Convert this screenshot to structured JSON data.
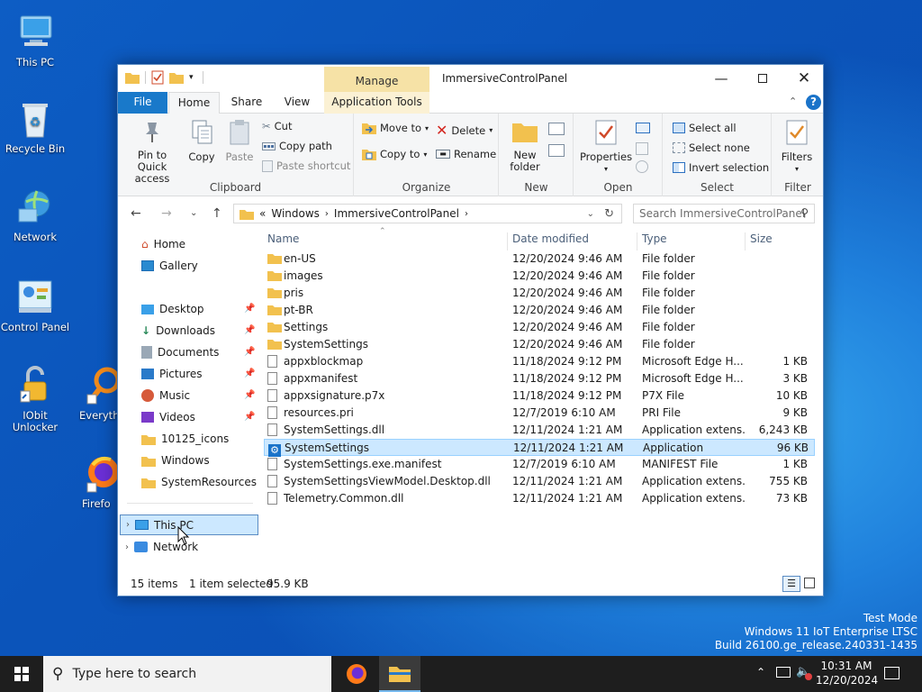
{
  "desktop": {
    "icons": [
      {
        "label": "This PC"
      },
      {
        "label": "Recycle Bin"
      },
      {
        "label": "Network"
      },
      {
        "label": "Control Panel"
      },
      {
        "label": "IObit Unlocker"
      },
      {
        "label": "Everyth"
      },
      {
        "label": "Firefo"
      }
    ],
    "watermark": {
      "line1": "Test Mode",
      "line2": "Windows 11 IoT Enterprise LTSC",
      "line3": "Build 26100.ge_release.240331-1435"
    }
  },
  "window": {
    "title": "ImmersiveControlPanel",
    "context_tab": "Manage",
    "tabs": {
      "file": "File",
      "home": "Home",
      "share": "Share",
      "view": "View",
      "apptools": "Application Tools"
    },
    "ribbon": {
      "clipboard": {
        "pin": "Pin to Quick access",
        "copy": "Copy",
        "paste": "Paste",
        "cut": "Cut",
        "copy_path": "Copy path",
        "paste_shortcut": "Paste shortcut",
        "label": "Clipboard"
      },
      "organize": {
        "move_to": "Move to",
        "copy_to": "Copy to",
        "delete": "Delete",
        "rename": "Rename",
        "label": "Organize"
      },
      "new": {
        "new_folder": "New folder",
        "label": "New"
      },
      "open": {
        "properties": "Properties",
        "label": "Open"
      },
      "select": {
        "select_all": "Select all",
        "select_none": "Select none",
        "invert": "Invert selection",
        "label": "Select"
      },
      "filter": {
        "filters": "Filters",
        "label": "Filter"
      }
    },
    "address": {
      "sep": "«",
      "crumb1": "Windows",
      "crumb2": "ImmersiveControlPanel",
      "search_placeholder": "Search ImmersiveControlPanel"
    },
    "nav": {
      "home": "Home",
      "gallery": "Gallery",
      "desktop": "Desktop",
      "downloads": "Downloads",
      "documents": "Documents",
      "pictures": "Pictures",
      "music": "Music",
      "videos": "Videos",
      "icons10125": "10125_icons",
      "windows": "Windows",
      "sysres": "SystemResources",
      "thispc": "This PC",
      "network": "Network"
    },
    "columns": {
      "name": "Name",
      "date": "Date modified",
      "type": "Type",
      "size": "Size"
    },
    "files": [
      {
        "name": "en-US",
        "date": "12/20/2024 9:46 AM",
        "type": "File folder",
        "size": ""
      },
      {
        "name": "images",
        "date": "12/20/2024 9:46 AM",
        "type": "File folder",
        "size": ""
      },
      {
        "name": "pris",
        "date": "12/20/2024 9:46 AM",
        "type": "File folder",
        "size": ""
      },
      {
        "name": "pt-BR",
        "date": "12/20/2024 9:46 AM",
        "type": "File folder",
        "size": ""
      },
      {
        "name": "Settings",
        "date": "12/20/2024 9:46 AM",
        "type": "File folder",
        "size": ""
      },
      {
        "name": "SystemSettings",
        "date": "12/20/2024 9:46 AM",
        "type": "File folder",
        "size": ""
      },
      {
        "name": "appxblockmap",
        "date": "11/18/2024 9:12 PM",
        "type": "Microsoft Edge H...",
        "size": "1 KB"
      },
      {
        "name": "appxmanifest",
        "date": "11/18/2024 9:12 PM",
        "type": "Microsoft Edge H...",
        "size": "3 KB"
      },
      {
        "name": "appxsignature.p7x",
        "date": "11/18/2024 9:12 PM",
        "type": "P7X File",
        "size": "10 KB"
      },
      {
        "name": "resources.pri",
        "date": "12/7/2019 6:10 AM",
        "type": "PRI File",
        "size": "9 KB"
      },
      {
        "name": "SystemSettings.dll",
        "date": "12/11/2024 1:21 AM",
        "type": "Application extens...",
        "size": "6,243 KB"
      },
      {
        "name": "SystemSettings",
        "date": "12/11/2024 1:21 AM",
        "type": "Application",
        "size": "96 KB"
      },
      {
        "name": "SystemSettings.exe.manifest",
        "date": "12/7/2019 6:10 AM",
        "type": "MANIFEST File",
        "size": "1 KB"
      },
      {
        "name": "SystemSettingsViewModel.Desktop.dll",
        "date": "12/11/2024 1:21 AM",
        "type": "Application extens...",
        "size": "755 KB"
      },
      {
        "name": "Telemetry.Common.dll",
        "date": "12/11/2024 1:21 AM",
        "type": "Application extens...",
        "size": "73 KB"
      }
    ],
    "status": {
      "count": "15 items",
      "selection": "1 item selected",
      "size": "95.9 KB"
    }
  },
  "taskbar": {
    "search_placeholder": "Type here to search",
    "time": "10:31 AM",
    "date": "12/20/2024"
  }
}
